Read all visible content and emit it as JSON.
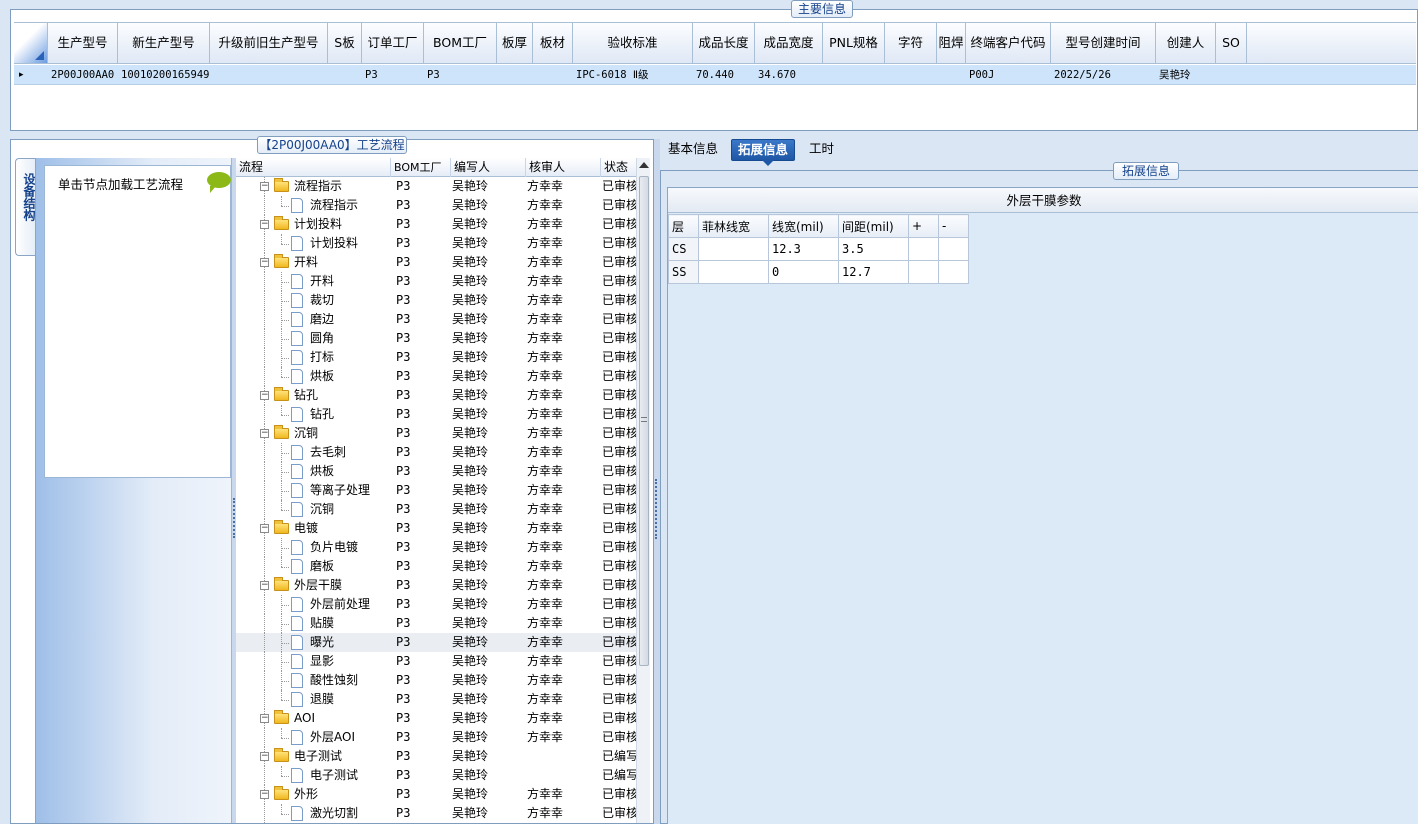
{
  "main_info": {
    "title": "主要信息",
    "columns": [
      "生产型号",
      "新生产型号",
      "升级前旧生产型号",
      "S板",
      "订单工厂",
      "BOM工厂",
      "板厚",
      "板材",
      "验收标准",
      "成品长度",
      "成品宽度",
      "PNL规格",
      "字符",
      "阻焊",
      "终端客户代码",
      "型号创建时间",
      "创建人",
      "SO"
    ],
    "row": {
      "indicator": "▸",
      "cells": [
        "2P00J00AA0",
        "10010200165949",
        "",
        "",
        "P3",
        "P3",
        "",
        "",
        "IPC-6018 Ⅱ级",
        "70.440",
        "34.670",
        "",
        "",
        "",
        "P00J",
        "2022/5/26",
        "吴艳玲",
        ""
      ]
    }
  },
  "process_flow": {
    "title": "【2P00J00AA0】工艺流程",
    "vertical_tab": "设备结构",
    "node_hint": "单击节点加载工艺流程",
    "columns": [
      "流程",
      "BOM工厂",
      "编写人",
      "核审人",
      "状态"
    ],
    "rows": [
      {
        "level": 0,
        "name": "流程指示",
        "bom": "P3",
        "writer": "吴艳玲",
        "reviewer": "方幸幸",
        "status": "已审核"
      },
      {
        "level": 1,
        "name": "流程指示",
        "bom": "P3",
        "writer": "吴艳玲",
        "reviewer": "方幸幸",
        "status": "已审核"
      },
      {
        "level": 0,
        "name": "计划投料",
        "bom": "P3",
        "writer": "吴艳玲",
        "reviewer": "方幸幸",
        "status": "已审核"
      },
      {
        "level": 1,
        "name": "计划投料",
        "bom": "P3",
        "writer": "吴艳玲",
        "reviewer": "方幸幸",
        "status": "已审核"
      },
      {
        "level": 0,
        "name": "开料",
        "bom": "P3",
        "writer": "吴艳玲",
        "reviewer": "方幸幸",
        "status": "已审核"
      },
      {
        "level": 1,
        "name": "开料",
        "bom": "P3",
        "writer": "吴艳玲",
        "reviewer": "方幸幸",
        "status": "已审核"
      },
      {
        "level": 1,
        "name": "裁切",
        "bom": "P3",
        "writer": "吴艳玲",
        "reviewer": "方幸幸",
        "status": "已审核"
      },
      {
        "level": 1,
        "name": "磨边",
        "bom": "P3",
        "writer": "吴艳玲",
        "reviewer": "方幸幸",
        "status": "已审核"
      },
      {
        "level": 1,
        "name": "圆角",
        "bom": "P3",
        "writer": "吴艳玲",
        "reviewer": "方幸幸",
        "status": "已审核"
      },
      {
        "level": 1,
        "name": "打标",
        "bom": "P3",
        "writer": "吴艳玲",
        "reviewer": "方幸幸",
        "status": "已审核"
      },
      {
        "level": 1,
        "name": "烘板",
        "bom": "P3",
        "writer": "吴艳玲",
        "reviewer": "方幸幸",
        "status": "已审核"
      },
      {
        "level": 0,
        "name": "钻孔",
        "bom": "P3",
        "writer": "吴艳玲",
        "reviewer": "方幸幸",
        "status": "已审核"
      },
      {
        "level": 1,
        "name": "钻孔",
        "bom": "P3",
        "writer": "吴艳玲",
        "reviewer": "方幸幸",
        "status": "已审核"
      },
      {
        "level": 0,
        "name": "沉铜",
        "bom": "P3",
        "writer": "吴艳玲",
        "reviewer": "方幸幸",
        "status": "已审核"
      },
      {
        "level": 1,
        "name": "去毛刺",
        "bom": "P3",
        "writer": "吴艳玲",
        "reviewer": "方幸幸",
        "status": "已审核"
      },
      {
        "level": 1,
        "name": "烘板",
        "bom": "P3",
        "writer": "吴艳玲",
        "reviewer": "方幸幸",
        "status": "已审核"
      },
      {
        "level": 1,
        "name": "等离子处理",
        "bom": "P3",
        "writer": "吴艳玲",
        "reviewer": "方幸幸",
        "status": "已审核"
      },
      {
        "level": 1,
        "name": "沉铜",
        "bom": "P3",
        "writer": "吴艳玲",
        "reviewer": "方幸幸",
        "status": "已审核"
      },
      {
        "level": 0,
        "name": "电镀",
        "bom": "P3",
        "writer": "吴艳玲",
        "reviewer": "方幸幸",
        "status": "已审核"
      },
      {
        "level": 1,
        "name": "负片电镀",
        "bom": "P3",
        "writer": "吴艳玲",
        "reviewer": "方幸幸",
        "status": "已审核"
      },
      {
        "level": 1,
        "name": "磨板",
        "bom": "P3",
        "writer": "吴艳玲",
        "reviewer": "方幸幸",
        "status": "已审核"
      },
      {
        "level": 0,
        "name": "外层干膜",
        "bom": "P3",
        "writer": "吴艳玲",
        "reviewer": "方幸幸",
        "status": "已审核"
      },
      {
        "level": 1,
        "name": "外层前处理",
        "bom": "P3",
        "writer": "吴艳玲",
        "reviewer": "方幸幸",
        "status": "已审核"
      },
      {
        "level": 1,
        "name": "贴膜",
        "bom": "P3",
        "writer": "吴艳玲",
        "reviewer": "方幸幸",
        "status": "已审核"
      },
      {
        "level": 1,
        "name": "曝光",
        "bom": "P3",
        "writer": "吴艳玲",
        "reviewer": "方幸幸",
        "status": "已审核",
        "selected": true
      },
      {
        "level": 1,
        "name": "显影",
        "bom": "P3",
        "writer": "吴艳玲",
        "reviewer": "方幸幸",
        "status": "已审核"
      },
      {
        "level": 1,
        "name": "酸性蚀刻",
        "bom": "P3",
        "writer": "吴艳玲",
        "reviewer": "方幸幸",
        "status": "已审核"
      },
      {
        "level": 1,
        "name": "退膜",
        "bom": "P3",
        "writer": "吴艳玲",
        "reviewer": "方幸幸",
        "status": "已审核"
      },
      {
        "level": 0,
        "name": "AOI",
        "bom": "P3",
        "writer": "吴艳玲",
        "reviewer": "方幸幸",
        "status": "已审核"
      },
      {
        "level": 1,
        "name": "外层AOI",
        "bom": "P3",
        "writer": "吴艳玲",
        "reviewer": "方幸幸",
        "status": "已审核"
      },
      {
        "level": 0,
        "name": "电子测试",
        "bom": "P3",
        "writer": "吴艳玲",
        "reviewer": "",
        "status": "已编写"
      },
      {
        "level": 1,
        "name": "电子测试",
        "bom": "P3",
        "writer": "吴艳玲",
        "reviewer": "",
        "status": "已编写"
      },
      {
        "level": 0,
        "name": "外形",
        "bom": "P3",
        "writer": "吴艳玲",
        "reviewer": "方幸幸",
        "status": "已审核"
      },
      {
        "level": 1,
        "name": "激光切割",
        "bom": "P3",
        "writer": "吴艳玲",
        "reviewer": "方幸幸",
        "status": "已审核"
      }
    ]
  },
  "right_tabs": [
    "基本信息",
    "拓展信息",
    "工时"
  ],
  "active_tab": 1,
  "ext_info": {
    "title": "拓展信息",
    "grid_title": "外层干膜参数",
    "columns": [
      "层",
      "菲林线宽",
      "线宽(mil)",
      "间距(mil)",
      "+",
      "-"
    ],
    "rows": [
      {
        "layer": "CS",
        "film": "",
        "width": "12.3",
        "spacing": "3.5"
      },
      {
        "layer": "SS",
        "film": "",
        "width": "0",
        "spacing": "12.7"
      }
    ]
  }
}
